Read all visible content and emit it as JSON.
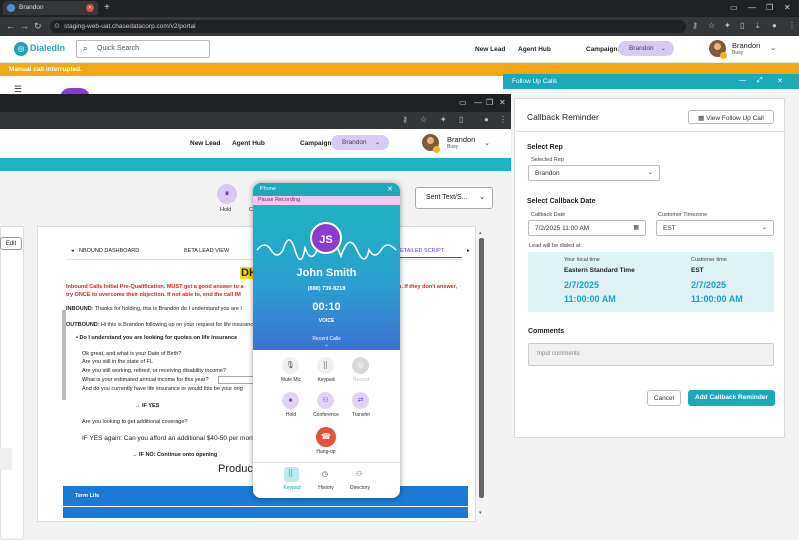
{
  "browser": {
    "tab_title": "Brandon",
    "url": "staging-web-uat.chasedatacorp.com/v2/portal"
  },
  "header": {
    "logo_text": "DialedIn",
    "search_placeholder": "Quick Search",
    "new_lead": "New Lead",
    "agent_hub": "Agent Hub",
    "campaign_label": "Campaign:",
    "campaign_value": "Brandon",
    "user_name": "Brandon",
    "user_status": "Busy"
  },
  "banner": {
    "text": "Manual call interrupted."
  },
  "followup": {
    "panel_title": "Follow Up Calls",
    "card_title": "Callback Reminder",
    "view_button": "View Follow Up Call",
    "select_rep_heading": "Select Rep",
    "selected_rep_label": "Selected Rep",
    "selected_rep_value": "Brandon",
    "select_date_heading": "Select Callback Date",
    "callback_date_label": "Callback Date",
    "callback_date_value": "7/2/2025 11:00 AM",
    "customer_tz_label": "Customer Timezone",
    "customer_tz_value": "EST",
    "dialed_at_label": "Lead will be dialed at:",
    "local_time_label": "Your local time",
    "local_tz": "Eastern Standard Time",
    "local_date": "2/7/2025",
    "local_time": "11:00:00 AM",
    "customer_time_label": "Customer time",
    "customer_tz": "EST",
    "customer_date": "2/7/2025",
    "customer_time": "11:00:00 AM",
    "comments_heading": "Comments",
    "comments_placeholder": "Input comments",
    "cancel": "Cancel",
    "add": "Add Callback Reminder"
  },
  "inner": {
    "new_lead": "New Lead",
    "agent_hub": "Agent Hub",
    "campaign_label": "Campaign:",
    "campaign_value": "Brandon",
    "user_name": "Brandon",
    "user_status": "Busy",
    "hold_label": "Hold",
    "hold_short": "C",
    "sent_text": "Sent Text/S...",
    "edit": "Edit",
    "tabs": [
      "NBOUND DASHBOARD",
      "BETA LEAD VIEW",
      "ETAILED SCRIPT"
    ],
    "script_title": "DH",
    "script_red1": "Inbound Calls Initial Pre-Qualification. MUST get a good answer to a",
    "script_red1b": "n. If they don't answer,",
    "script_red2": "try ONCE to overcome their objection. If not able to, end the call IM",
    "inbound_lbl": "INBOUND",
    "inbound_txt": ": Thanks for holding, this is Brandon do I understand you are l",
    "outbound_lbl": "OUTBOUND",
    "outbound_txt": ": Hi this is Brandon following up on your request for life insuranc",
    "bullet1": "Do I understand you are looking for quotes on life insurance",
    "line_ok": "Ok great, and what is your Date of Birth?",
    "line_fl": "Are you still in the state of FL",
    "line_work": "Are you still working, retired, or receiving disability income?",
    "line_income": "What is your estimated annual income for this year?",
    "line_afford": "And do you currently have life insurance or would this be your orig",
    "if_yes": "→ IF YES",
    "coverage": "Are you looking to get additional coverage?",
    "if_yes_again": "IF YES again: Can you afford an additional $40-50 per month",
    "if_no": "→ IF NO: Continue onto opening",
    "produc": "Produc",
    "term_life": "Term Life"
  },
  "phone": {
    "title": "Phone",
    "pause_recording": "Pause Recording",
    "initials": "JS",
    "name": "John Smith",
    "number": "(888) 739-8218",
    "timer": "00:10",
    "mode": "VOICE",
    "recent_calls": "Recent Calls",
    "buttons": [
      "Mute Mic",
      "Keypad",
      "Record",
      "Hold",
      "Conference",
      "Transfer"
    ],
    "hangup": "Hang-up",
    "footer": [
      "Keypad",
      "History",
      "Directory"
    ]
  },
  "colors": {
    "teal": "#1aaab9",
    "banner_orange": "#f3a712",
    "campaign_pill": "#d9c9f3",
    "avatar_purple": "#8c3bcf",
    "hangup_red": "#e4523d",
    "term_life_blue": "#1a7ad6"
  }
}
